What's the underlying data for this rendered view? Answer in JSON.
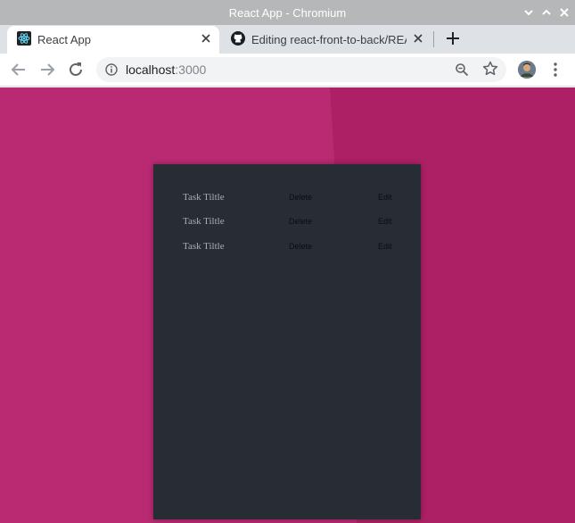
{
  "window": {
    "title": "React App - Chromium",
    "controls": [
      "minimize",
      "maximize",
      "close"
    ]
  },
  "tabs": [
    {
      "label": "React App",
      "icon": "react-icon",
      "active": true
    },
    {
      "label": "Editing react-front-to-back/REA",
      "icon": "github-icon",
      "active": false
    }
  ],
  "omnibox": {
    "host": "localhost",
    "port": ":3000"
  },
  "page": {
    "tasks": [
      {
        "title": "Task Tiltle",
        "delete_label": "Delete",
        "edit_label": "Edit"
      },
      {
        "title": "Task Tiltle",
        "delete_label": "Delete",
        "edit_label": "Edit"
      },
      {
        "title": "Task Tiltle",
        "delete_label": "Delete",
        "edit_label": "Edit"
      }
    ]
  },
  "colors": {
    "page_background": "#b92a73",
    "card_background": "#282c35",
    "titlebar": "#b5b7b9",
    "tabstrip": "#dee1e6"
  }
}
